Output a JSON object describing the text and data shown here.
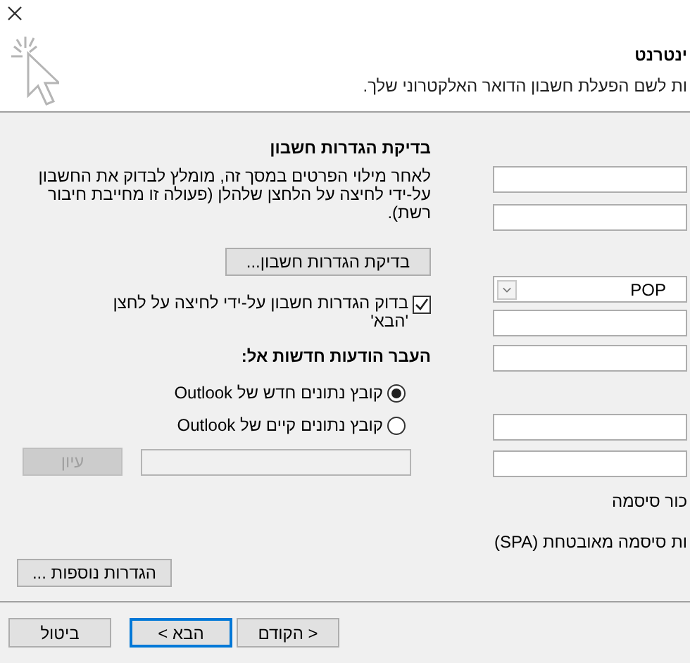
{
  "header": {
    "title": "ינטרנט",
    "subtitle": "ות לשם הפעלת חשבון הדואר האלקטרוני שלך."
  },
  "test_section": {
    "title": "בדיקת הגדרות חשבון",
    "description": "לאחר מילוי הפרטים במסך זה, מומלץ לבדוק את החשבון על-ידי לחיצה על הלחצן שלהלן (פעולה זו מחייבת חיבור רשת).",
    "test_button": "בדיקת הגדרות חשבון...",
    "auto_test": {
      "label": "בדוק הגדרות חשבון על-ידי לחיצה על לחצן 'הבא'",
      "checked": true
    }
  },
  "deliver": {
    "title": "העבר הודעות חדשות אל:",
    "options": [
      {
        "label": "קובץ נתונים חדש של Outlook",
        "selected": true
      },
      {
        "label": "קובץ נתונים קיים של Outlook",
        "selected": false
      }
    ],
    "path_field": {
      "disabled": true
    },
    "browse_button": {
      "label": "עיון",
      "disabled": true
    }
  },
  "more_settings_button": "הגדרות נוספות ...",
  "right_fields": [
    {
      "kind": "text"
    },
    {
      "kind": "text"
    },
    {
      "kind": "combo",
      "value": "POP"
    },
    {
      "kind": "text"
    },
    {
      "kind": "text"
    },
    {
      "kind": "text"
    },
    {
      "kind": "text"
    }
  ],
  "right_labels": [
    "כור סיסמה",
    "ות סיסמה מאובטחת (SPA)"
  ],
  "footer": {
    "buttons": [
      {
        "label": "< הקודם",
        "focused": false
      },
      {
        "label": "הבא >",
        "focused": true
      },
      {
        "label": "ביטול",
        "focused": false
      }
    ]
  }
}
